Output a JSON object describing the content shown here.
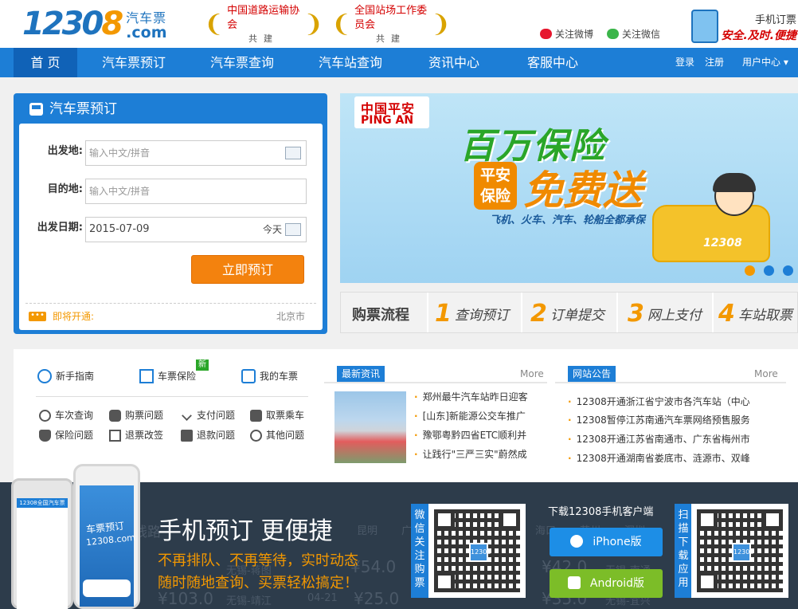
{
  "header": {
    "logo_num": "1230",
    "logo_o": "8",
    "logo_cn": "汽车票",
    "logo_com": ".com",
    "partners": [
      {
        "name": "中国道路运输协会",
        "sub": "共建"
      },
      {
        "name": "全国站场工作委员会",
        "sub": "共建"
      }
    ],
    "follow_weibo": "关注微博",
    "follow_wechat": "关注微信",
    "mobile_line1": "手机订票",
    "mobile_line2": "安全.及时.便捷"
  },
  "nav": {
    "items": [
      "首 页",
      "汽车票预订",
      "汽车票查询",
      "汽车站查询",
      "资讯中心",
      "客服中心"
    ],
    "login": "登录",
    "register": "注册",
    "user_center": "用户中心"
  },
  "booking": {
    "title": "汽车票预订",
    "from_label": "出发地:",
    "from_placeholder": "输入中文/拼音",
    "to_label": "目的地:",
    "to_placeholder": "输入中文/拼音",
    "date_label": "出发日期:",
    "date_value": "2015-07-09",
    "today": "今天",
    "submit": "立即预订",
    "soon_label": "即将开通:",
    "soon_city": "北京市"
  },
  "banner": {
    "brand_cn": "中国平安",
    "brand_en": "PING AN",
    "headline1": "百万保险",
    "tag": "平安保险",
    "headline2": "免费送",
    "slogan": "飞机、火车、汽车、轮船全都承保",
    "bus_brand": "12308"
  },
  "process": {
    "title": "购票流程",
    "steps": [
      {
        "n": "1",
        "t": "查询预订"
      },
      {
        "n": "2",
        "t": "订单提交"
      },
      {
        "n": "3",
        "t": "网上支付"
      },
      {
        "n": "4",
        "t": "车站取票"
      }
    ]
  },
  "guide": {
    "main": [
      "新手指南",
      "车票保险",
      "我的车票"
    ],
    "new_badge": "新",
    "links": [
      "车次查询",
      "购票问题",
      "支付问题",
      "取票乘车",
      "保险问题",
      "退票改签",
      "退款问题",
      "其他问题"
    ]
  },
  "news": {
    "title": "最新资讯",
    "more": "More",
    "items": [
      "郑州最牛汽车站昨日迎客",
      "[山东]新能源公交车推广",
      "豫鄂粤黔四省ETC顺利并",
      "让践行\"三严三实\"蔚然成"
    ]
  },
  "notice": {
    "title": "网站公告",
    "more": "More",
    "items": [
      "12308开通浙江省宁波市各汽车站（中心",
      "12308暂停江苏南通汽车票网络预售服务",
      "12308开通江苏省南通市、广东省梅州市",
      "12308开通湖南省娄底市、涟源市、双峰"
    ]
  },
  "promo": {
    "title": "手机预订 更便捷",
    "line1": "不再排队、不再等待，实时动态",
    "line2": "随时随地查询、买票轻松搞定！",
    "wechat_label": "微信关注购票",
    "download_title": "下载12308手机客户端",
    "iphone": "iPhone版",
    "android": "Android版",
    "scan_label": "扫描下载应用",
    "qr_logo": "12308",
    "phone_back_bar": "12308全国汽车票",
    "phone_front_t1": "车票预订",
    "phone_front_t2": "12308.com",
    "ghost": [
      "线路",
      "昆明",
      "广",
      "海口",
      "苏州",
      "深圳",
      "无锡-蒋图",
      "¥54.0",
      "¥42.0",
      "无锡-南通",
      "¥103.0",
      "无锡-靖江",
      "04-21",
      "¥25.0",
      "无锡-宜兴",
      "¥35.0"
    ]
  },
  "colors": {
    "primary": "#1d7ed6",
    "nav_active": "#1062b7",
    "accent": "#f39800",
    "button": "#f3820e",
    "promo_bg": "#2d3c4b",
    "android": "#7cbd28"
  }
}
